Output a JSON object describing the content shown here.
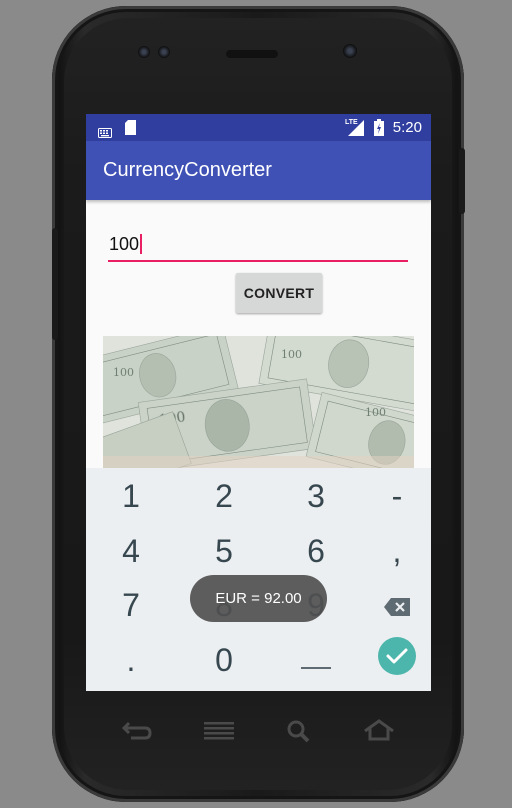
{
  "status_bar": {
    "network": "LTE",
    "time": "5:20",
    "icons": [
      "keyboard-icon",
      "sd-card-icon",
      "signal-icon",
      "battery-icon"
    ]
  },
  "app": {
    "title": "CurrencyConverter"
  },
  "amount_input": {
    "value": "100"
  },
  "convert_button": {
    "label": "CONVERT"
  },
  "image": {
    "description_icon": "dollar-bills-image"
  },
  "keyboard": {
    "rows": [
      [
        "1",
        "2",
        "3",
        "-"
      ],
      [
        "4",
        "5",
        "6",
        ","
      ],
      [
        "7",
        "8",
        "9",
        "backspace-icon"
      ],
      [
        ".",
        "0",
        "_",
        "done-icon"
      ]
    ],
    "accent_color": "#4db6ac"
  },
  "toast": {
    "text": "EUR = 92.00"
  },
  "colors": {
    "status_bar": "#303f9f",
    "app_bar": "#3f51b5",
    "input_underline": "#e91e63"
  }
}
